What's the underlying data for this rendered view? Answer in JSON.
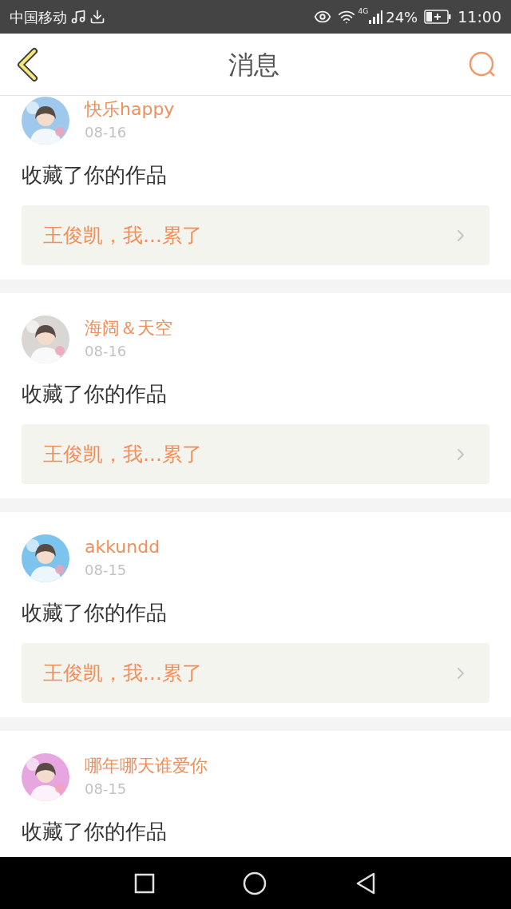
{
  "status_bar": {
    "carrier": "中国移动",
    "network": "4G",
    "battery": "24%",
    "time": "11:00"
  },
  "header": {
    "title": "消息"
  },
  "messages": [
    {
      "name": "快乐happy",
      "date": "08-16",
      "action": "收藏了你的作品",
      "work": "王俊凯，我...累了"
    },
    {
      "name": "海阔＆天空",
      "date": "08-16",
      "action": "收藏了你的作品",
      "work": "王俊凯，我...累了"
    },
    {
      "name": "akkundd",
      "date": "08-15",
      "action": "收藏了你的作品",
      "work": "王俊凯，我...累了"
    },
    {
      "name": "哪年哪天谁爱你",
      "date": "08-15",
      "action": "收藏了你的作品"
    }
  ]
}
